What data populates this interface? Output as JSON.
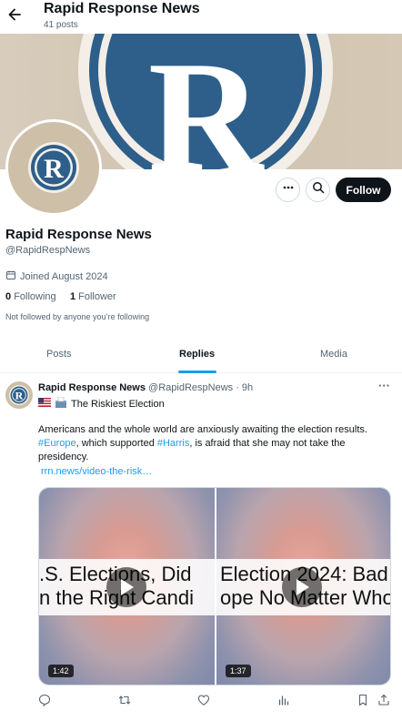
{
  "header": {
    "title": "Rapid Response News",
    "subtitle": "41 posts"
  },
  "profile": {
    "name": "Rapid Response News",
    "handle": "@RapidRespNews",
    "joined": "Joined August 2024",
    "following_count": "0",
    "following_label": "Following",
    "follower_count": "1",
    "follower_label": "Follower",
    "not_followed": "Not followed by anyone you’re following",
    "follow_label": "Follow",
    "logo_letter": "R",
    "accent": "#2d5f8a"
  },
  "tabs": [
    {
      "label": "Posts",
      "active": false
    },
    {
      "label": "Replies",
      "active": true
    },
    {
      "label": "Media",
      "active": false
    }
  ],
  "post": {
    "author": "Rapid Response News",
    "handle_time": "@RapidRespNews · 9h",
    "title_line": "The Riskiest Election",
    "body_part1": "Americans and the whole world are anxiously awaiting the election results. ",
    "tag1": "#Europe",
    "body_part2": ", which supported ",
    "tag2": "#Harris",
    "body_part3": ", is afraid that she may not take the presidency.",
    "url": "rrn.news/video-the-risk…",
    "videos": [
      {
        "line1": ".S. Elections, Did",
        "line2": "n the Right Candi",
        "duration": "1:42"
      },
      {
        "line1": "Election 2024: Bad",
        "line2": "ope No Matter Who",
        "duration": "1:37"
      }
    ]
  },
  "icons": {
    "back": "arrow-left-icon",
    "more": "more-icon",
    "search": "search-icon",
    "calendar": "calendar-icon",
    "flag": "us-flag-icon",
    "ballot": "ballot-box-icon",
    "reply": "reply-icon",
    "repost": "repost-icon",
    "like": "like-icon",
    "views": "views-icon",
    "bookmark": "bookmark-icon",
    "share": "share-icon"
  },
  "colors": {
    "link": "#1d9bf0",
    "tab_underline": "#1d9bf0",
    "follow_bg": "#0f1419"
  }
}
